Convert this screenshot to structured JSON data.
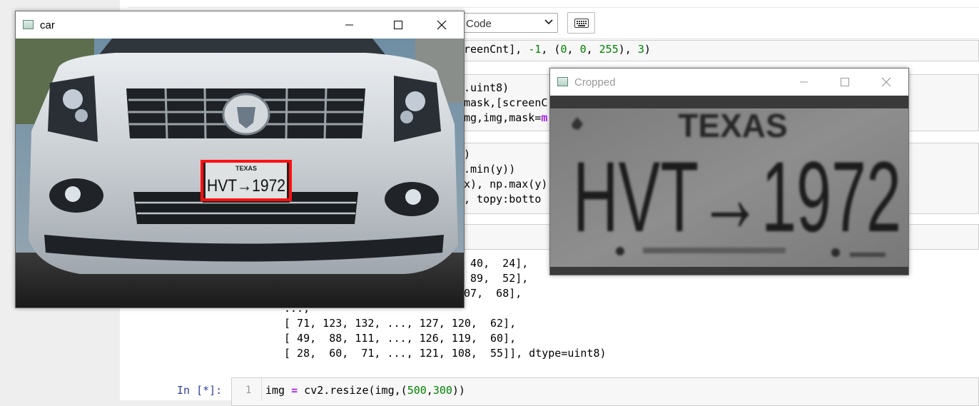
{
  "toolbar": {
    "cell_type_value": "Code",
    "keyboard_icon": "keyboard-icon"
  },
  "code_lines": {
    "l1": "reenCnt], ",
    "l1b": "-1",
    "l1c": ", (",
    "l1d": "0",
    "l1e": ", ",
    "l1f": "0",
    "l1g": ", ",
    "l1h": "255",
    "l1i": "), ",
    "l1j": "3",
    "l1k": ")",
    "l2": ".uint8)",
    "l3": "mask,[screenC",
    "l4a": "mg,img,mask=",
    "l4b": "m",
    "l5": ")",
    "l6": ".min(y))",
    "l7": "x), np.max(y)",
    "l8": ", topy:botto"
  },
  "output": {
    "r1": " 40,  24],",
    "r2": " 89,  52],",
    "r3": "107,  68],",
    "ellipsis": "...,",
    "r4": "[ 71, 123, 132, ..., 127, 120,  62],",
    "r5": "[ 49,  88, 111, ..., 126, 119,  60],",
    "r6": "[ 28,  60,  71, ..., 121, 108,  55]], dtype=uint8)"
  },
  "last_cell": {
    "prompt": "In [*]:",
    "line_number": "1",
    "code_a": "img ",
    "code_op": "=",
    "code_b": " cv2.resize(img,(",
    "code_n1": "500",
    "code_c": ",",
    "code_n2": "300",
    "code_d": "))"
  },
  "car_window": {
    "title": "car",
    "plate_top": "TEXAS",
    "plate_text": "HVT→1972"
  },
  "cropped_window": {
    "title": "Cropped",
    "plate_top": "TEXAS",
    "plate_text": "HVT→1972"
  }
}
